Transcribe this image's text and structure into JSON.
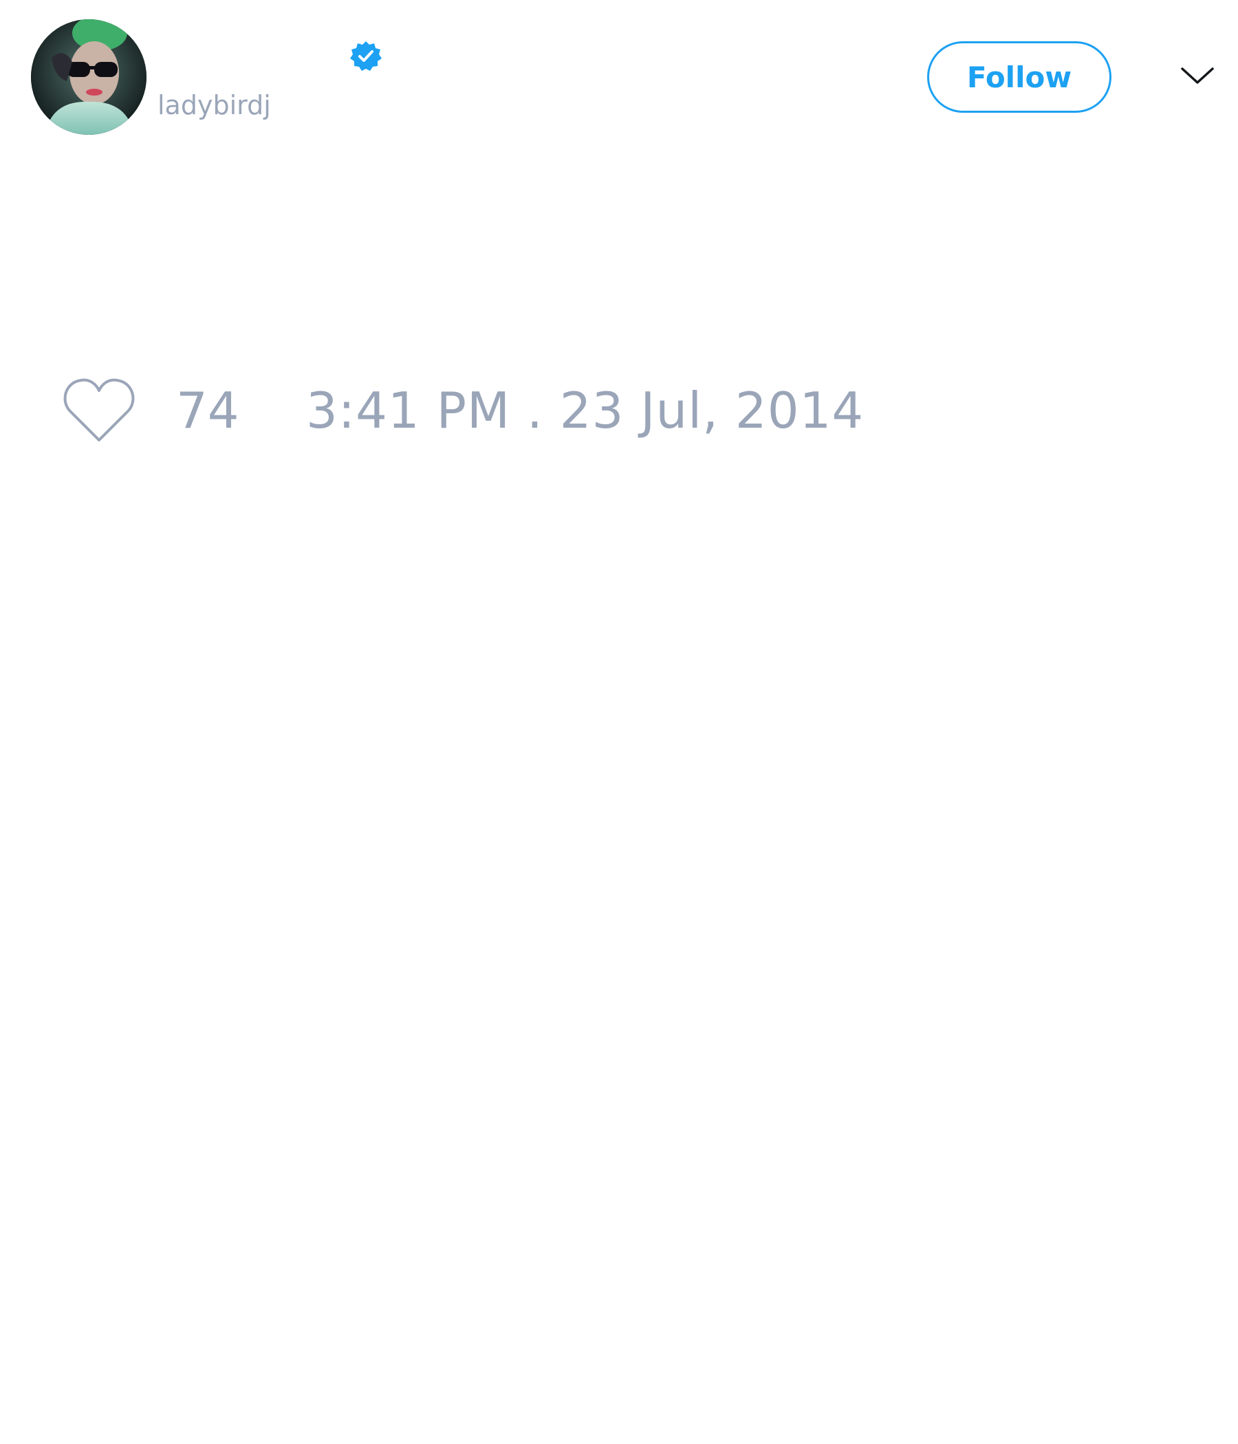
{
  "tweet": {
    "author": {
      "display_name": "",
      "handle": "ladybirdj",
      "verified": true,
      "avatar_icon": "avatar-photo",
      "verified_icon": "verified-badge-icon"
    },
    "follow_label": "Follow",
    "menu_icon": "chevron-down-icon",
    "like_icon": "heart-outline-icon",
    "like_count": "74",
    "timestamp": "3:41 PM . 23 Jul, 2014"
  },
  "colors": {
    "accent": "#1da1f2",
    "muted_text": "#9aa5b8",
    "background": "#ffffff"
  }
}
